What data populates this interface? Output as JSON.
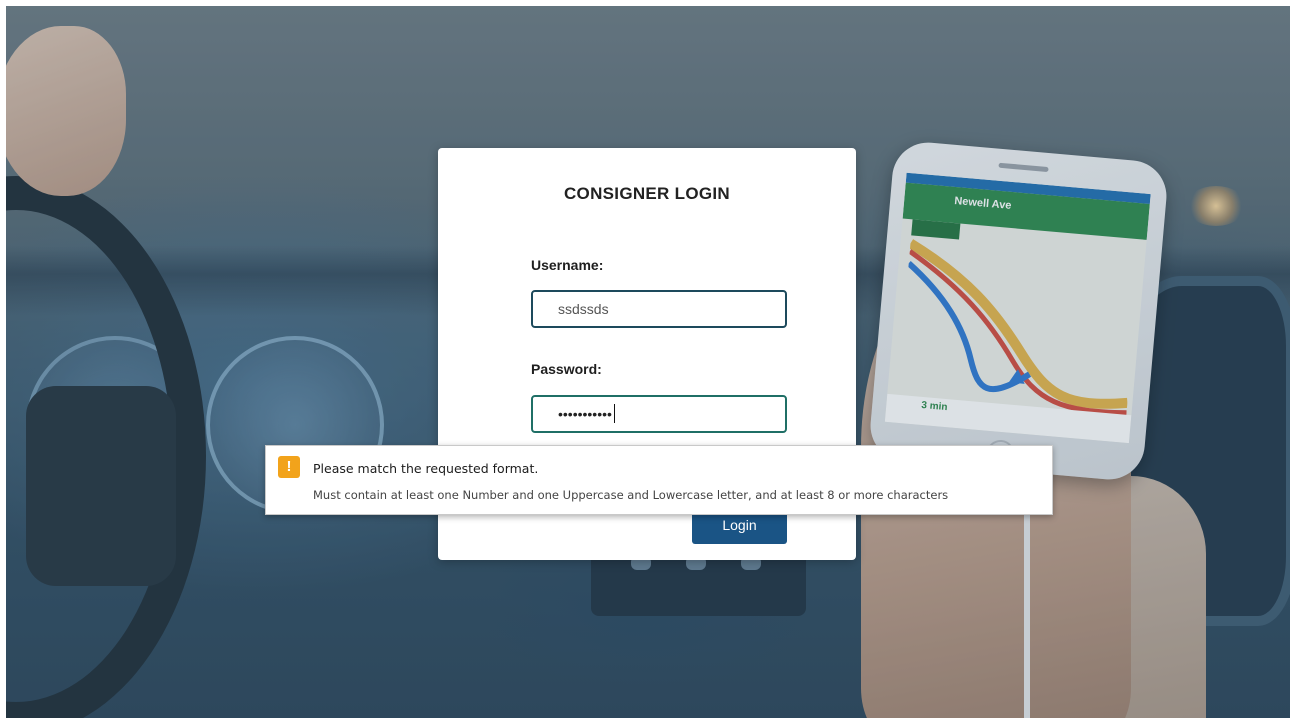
{
  "login": {
    "title": "CONSIGNER LOGIN",
    "username_label": "Username:",
    "username_value": "ssdssds",
    "password_label": "Password:",
    "password_masked": "•••••••••••",
    "login_button": "Login"
  },
  "validation": {
    "message": "Please match the requested format.",
    "detail": "Must contain at least one Number and one Uppercase and Lowercase letter, and at least 8 or more characters",
    "icon": "warning-icon",
    "icon_glyph": "!",
    "icon_color": "#f2a31b"
  },
  "background_phone": {
    "street": "Newell Ave",
    "eta": "3 min"
  },
  "colors": {
    "button": "#1a5485",
    "field_border": "#1d4a5c",
    "focused_field_border": "#1f6f66"
  }
}
